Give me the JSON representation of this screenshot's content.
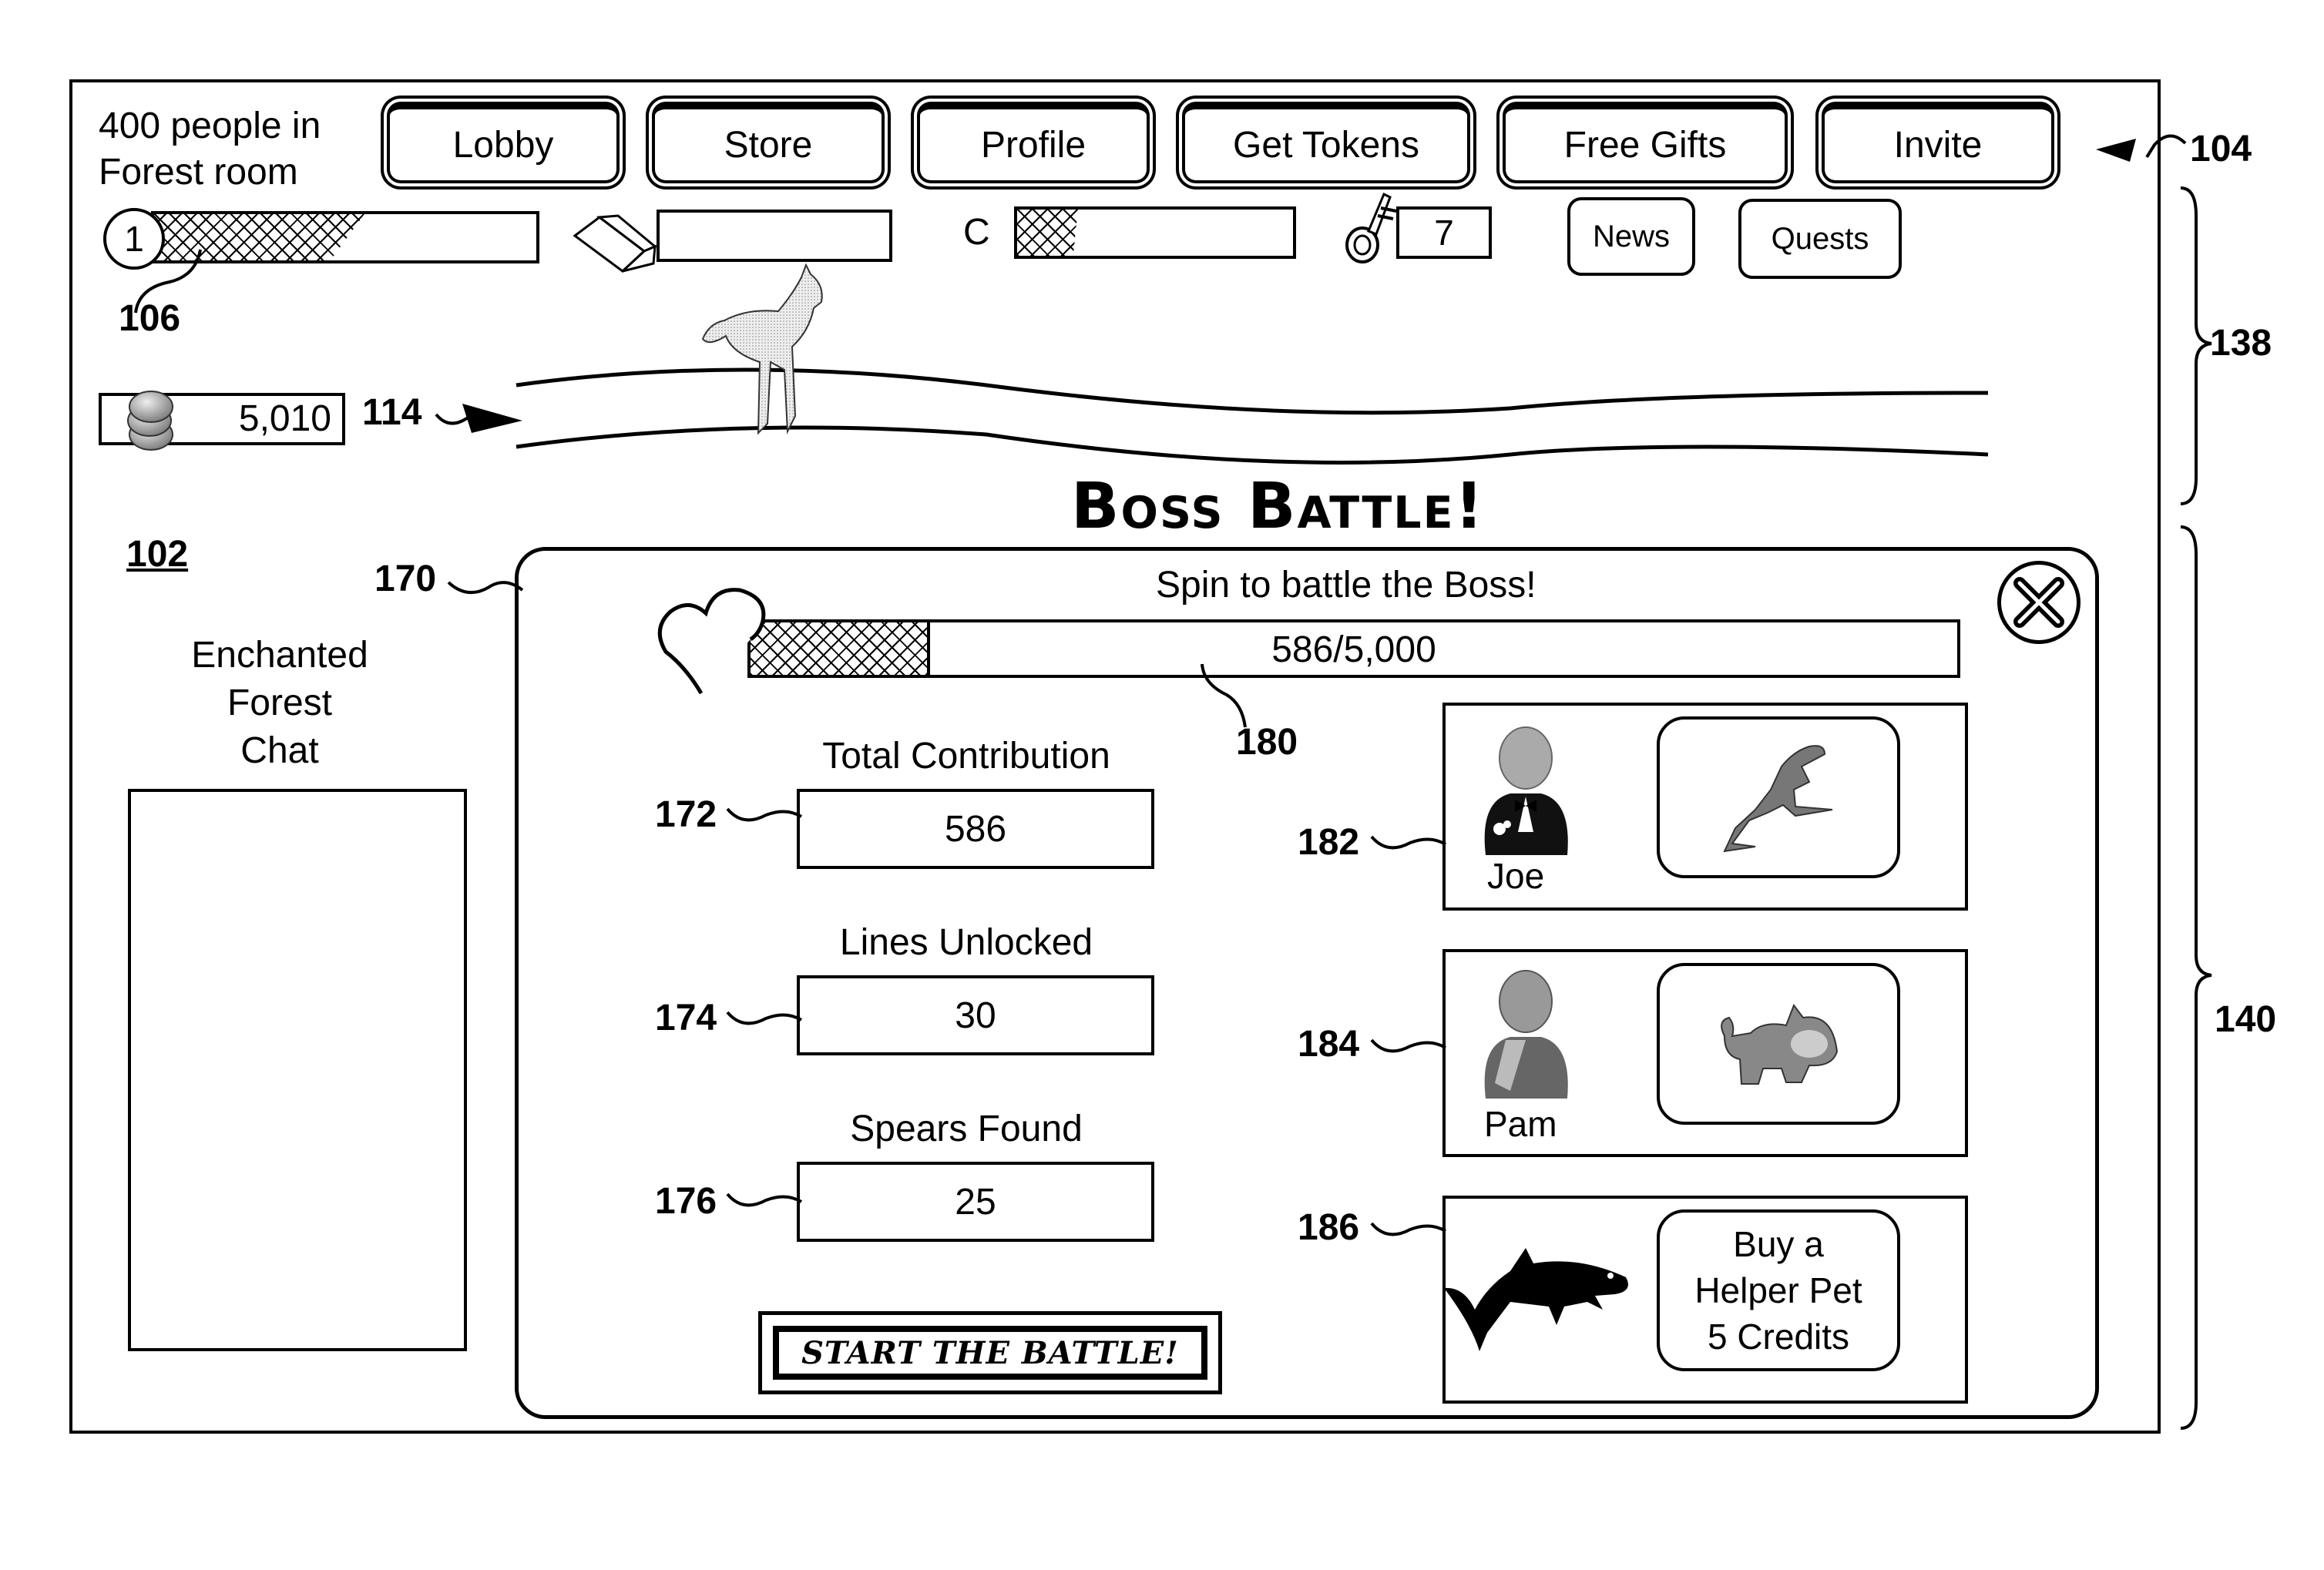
{
  "header": {
    "room_line1": "400 people in",
    "room_line2": "Forest room",
    "nav": [
      {
        "label": "Lobby"
      },
      {
        "label": "Store"
      },
      {
        "label": "Profile"
      },
      {
        "label": "Get Tokens"
      },
      {
        "label": "Free Gifts"
      },
      {
        "label": "Invite"
      }
    ]
  },
  "status": {
    "level": "1",
    "level_progress_pct": 55,
    "gold_progress_pct": 0,
    "c_label": "C",
    "c_progress_pct": 22,
    "keys": "7",
    "news_label": "News",
    "quests_label": "Quests",
    "coins": "5,010"
  },
  "refs": {
    "r104": "104",
    "r106": "106",
    "r114": "114",
    "r138": "138",
    "r140": "140",
    "r102": "102",
    "r170": "170",
    "r172": "172",
    "r174": "174",
    "r176": "176",
    "r180": "180",
    "r182": "182",
    "r184": "184",
    "r186": "186"
  },
  "chat": {
    "title_line1": "Enchanted",
    "title_line2": "Forest",
    "title_line3": "Chat"
  },
  "boss": {
    "title": "Boss Battle!",
    "subtitle": "Spin to battle the Boss!",
    "health_text": "586/5,000",
    "health_current": 586,
    "health_max": 5000,
    "stats": [
      {
        "label": "Total Contribution",
        "value": "586"
      },
      {
        "label": "Lines Unlocked",
        "value": "30"
      },
      {
        "label": "Spears Found",
        "value": "25"
      }
    ],
    "start_label": "START THE BATTLE!",
    "helpers": [
      {
        "name": "Joe",
        "pet": "frog-icon"
      },
      {
        "name": "Pam",
        "pet": "dog-icon"
      }
    ],
    "buy_line1": "Buy a",
    "buy_line2": "Helper Pet",
    "buy_line3": "5 Credits"
  }
}
